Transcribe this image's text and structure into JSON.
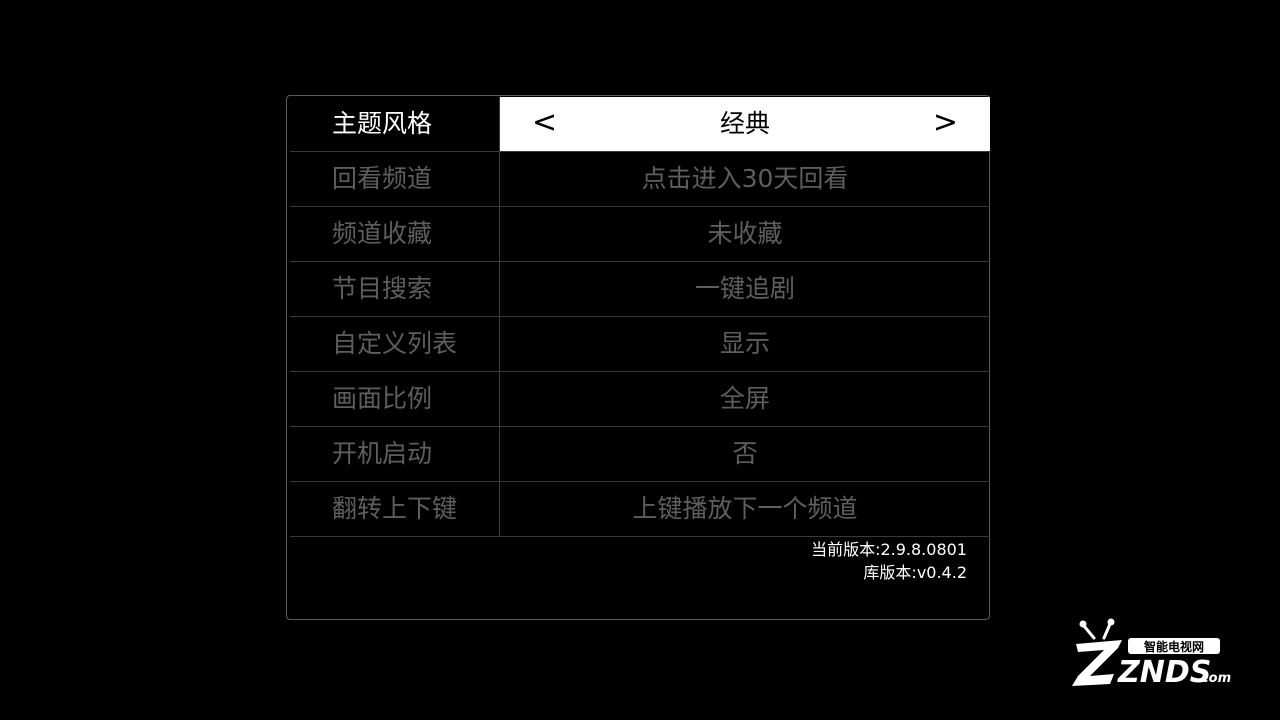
{
  "settings": {
    "items": [
      {
        "label": "主题风格",
        "value": "经典",
        "prev_arrow": "<",
        "next_arrow": ">"
      },
      {
        "label": "回看频道",
        "value": "点击进入30天回看"
      },
      {
        "label": "频道收藏",
        "value": "未收藏"
      },
      {
        "label": "节目搜索",
        "value": "一键追剧"
      },
      {
        "label": "自定义列表",
        "value": "显示"
      },
      {
        "label": "画面比例",
        "value": "全屏"
      },
      {
        "label": "开机启动",
        "value": "否"
      },
      {
        "label": "翻转上下键",
        "value": "上键播放下一个频道"
      }
    ]
  },
  "version": {
    "app_version": "当前版本:2.9.8.0801",
    "lib_version": "库版本:v0.4.2"
  },
  "watermark": {
    "tagline": "智能电视网",
    "brand": "ZNDS",
    "domain": ".com"
  },
  "colors": {
    "background": "#000000",
    "highlight": "#ffffff",
    "inactive_text": "#5e5e5e"
  }
}
